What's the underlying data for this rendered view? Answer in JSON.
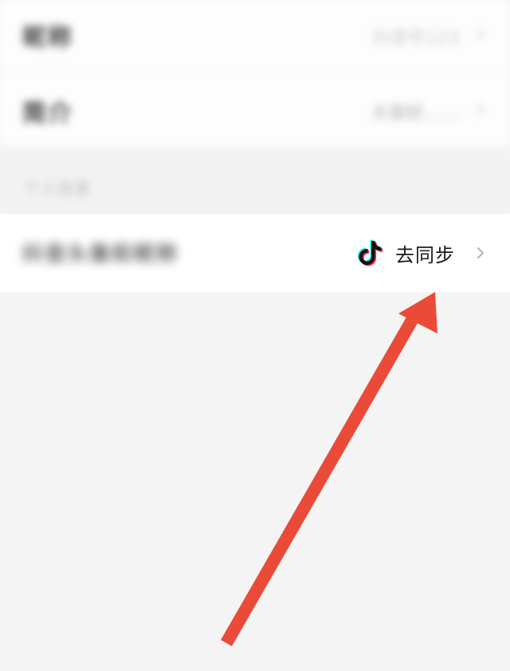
{
  "rows": [
    {
      "label": "昵称",
      "value": "抖音号123"
    },
    {
      "label": "简介",
      "value": "大家好……"
    },
    {
      "label": "抖音头像和昵称",
      "value": "去同步"
    }
  ],
  "section": {
    "label": "个人信息"
  },
  "colors": {
    "background": "#f4f4f4",
    "row": "#ffffff",
    "arrow": "#ea4b38",
    "tiktok_cyan": "#25f4ee",
    "tiktok_red": "#fe2c55"
  },
  "icons": {
    "tiktok": "tiktok-logo-icon",
    "chevron": "chevron-right-icon",
    "annotation": "red-arrow-annotation"
  }
}
